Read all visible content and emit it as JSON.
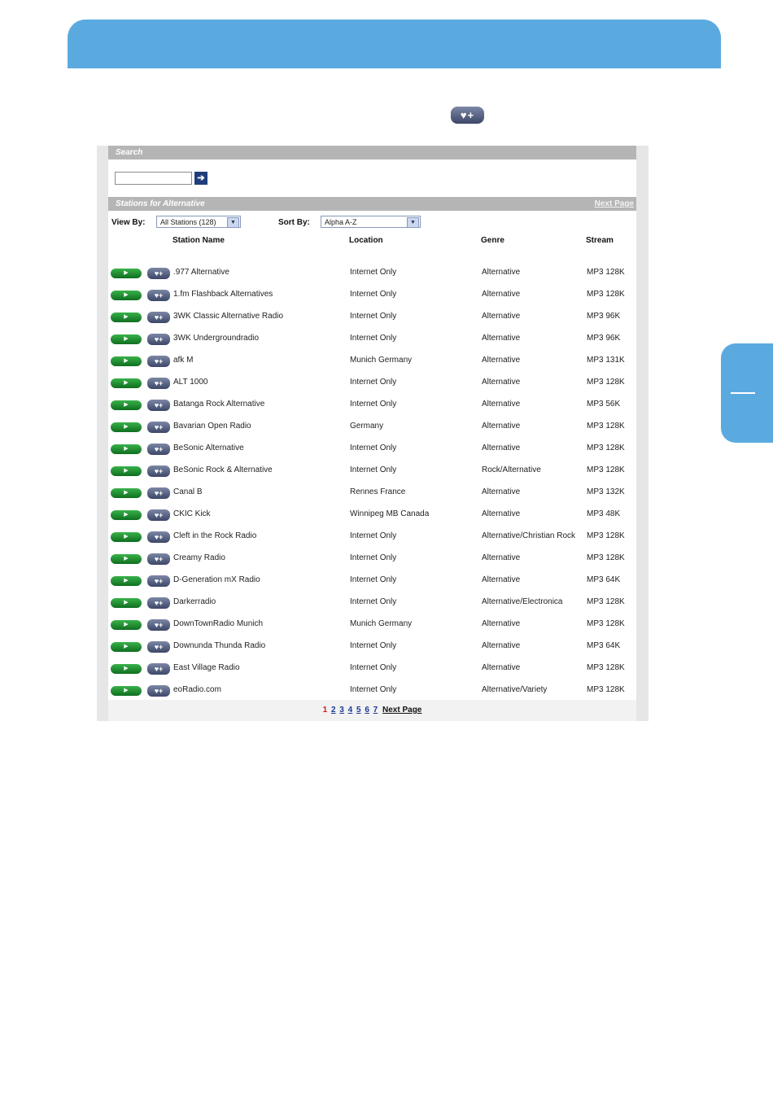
{
  "search": {
    "title": "Search",
    "go_icon": "arrow-right-icon"
  },
  "stations_bar": {
    "title": "Stations for Alternative",
    "next_page": "Next Page"
  },
  "filters": {
    "view_by_label": "View By:",
    "view_by_value": "All Stations (128)",
    "sort_by_label": "Sort By:",
    "sort_by_value": "Alpha A-Z"
  },
  "columns": {
    "name": "Station Name",
    "location": "Location",
    "genre": "Genre",
    "stream": "Stream"
  },
  "stations": [
    {
      "name": ".977 Alternative",
      "location": "Internet Only",
      "genre": "Alternative",
      "stream": "MP3 128K"
    },
    {
      "name": "1.fm Flashback Alternatives",
      "location": "Internet Only",
      "genre": "Alternative",
      "stream": "MP3 128K"
    },
    {
      "name": "3WK Classic Alternative Radio",
      "location": "Internet Only",
      "genre": "Alternative",
      "stream": "MP3 96K"
    },
    {
      "name": "3WK Undergroundradio",
      "location": "Internet Only",
      "genre": "Alternative",
      "stream": "MP3 96K"
    },
    {
      "name": "afk M",
      "location": "Munich Germany",
      "genre": "Alternative",
      "stream": "MP3 131K"
    },
    {
      "name": "ALT 1000",
      "location": "Internet Only",
      "genre": "Alternative",
      "stream": "MP3 128K"
    },
    {
      "name": "Batanga Rock Alternative",
      "location": "Internet Only",
      "genre": "Alternative",
      "stream": "MP3 56K"
    },
    {
      "name": "Bavarian Open Radio",
      "location": "Germany",
      "genre": "Alternative",
      "stream": "MP3 128K"
    },
    {
      "name": "BeSonic Alternative",
      "location": "Internet Only",
      "genre": "Alternative",
      "stream": "MP3 128K"
    },
    {
      "name": "BeSonic Rock & Alternative",
      "location": "Internet Only",
      "genre": "Rock/Alternative",
      "stream": "MP3 128K"
    },
    {
      "name": "Canal B",
      "location": "Rennes France",
      "genre": "Alternative",
      "stream": "MP3 132K"
    },
    {
      "name": "CKIC Kick",
      "location": "Winnipeg MB Canada",
      "genre": "Alternative",
      "stream": "MP3 48K"
    },
    {
      "name": "Cleft in the Rock Radio",
      "location": "Internet Only",
      "genre": "Alternative/Christian Rock",
      "stream": "MP3 128K"
    },
    {
      "name": "Creamy Radio",
      "location": "Internet Only",
      "genre": "Alternative",
      "stream": "MP3 128K"
    },
    {
      "name": "D-Generation mX Radio",
      "location": "Internet Only",
      "genre": "Alternative",
      "stream": "MP3 64K"
    },
    {
      "name": "Darkerradio",
      "location": "Internet Only",
      "genre": "Alternative/Electronica",
      "stream": "MP3 128K"
    },
    {
      "name": "DownTownRadio Munich",
      "location": "Munich Germany",
      "genre": "Alternative",
      "stream": "MP3 128K"
    },
    {
      "name": "Downunda Thunda Radio",
      "location": "Internet Only",
      "genre": "Alternative",
      "stream": "MP3 64K"
    },
    {
      "name": "East Village Radio",
      "location": "Internet Only",
      "genre": "Alternative",
      "stream": "MP3 128K"
    },
    {
      "name": "eoRadio.com",
      "location": "Internet Only",
      "genre": "Alternative/Variety",
      "stream": "MP3 128K"
    }
  ],
  "pagination": {
    "current": "1",
    "pages": [
      "2",
      "3",
      "4",
      "5",
      "6",
      "7"
    ],
    "next": "Next Page"
  },
  "icons": {
    "play": "play-icon",
    "favorite_add": "heart-plus-icon"
  },
  "colors": {
    "banner": "#5aaae0",
    "bar": "#b5b5b5",
    "play": "#1e8a2e",
    "favorite": "#4a5577"
  }
}
